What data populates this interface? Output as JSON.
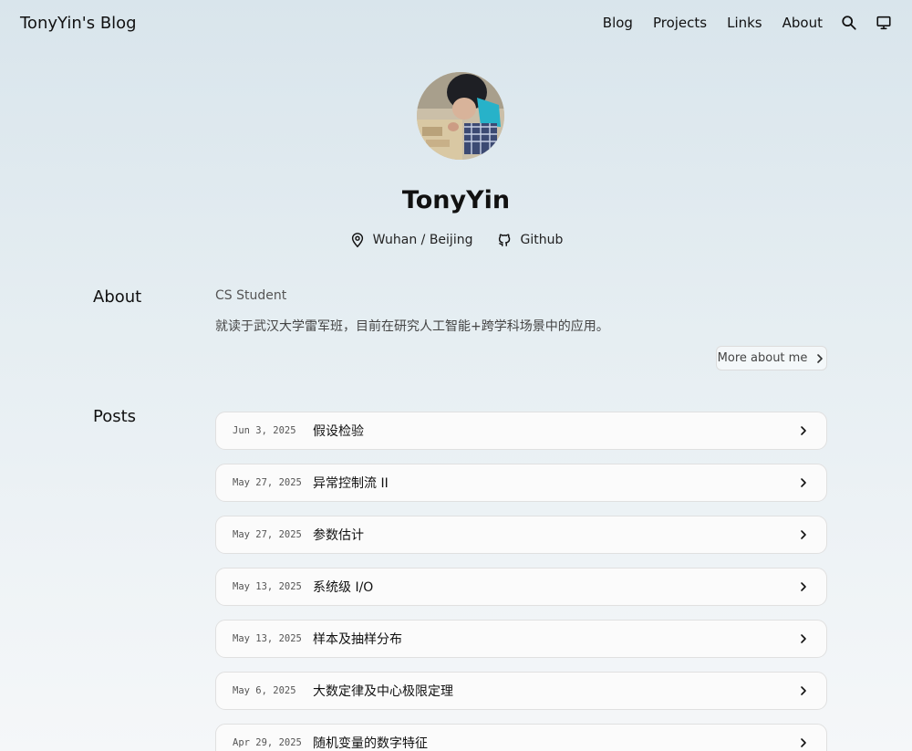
{
  "header": {
    "site_title": "TonyYin's Blog",
    "nav": [
      "Blog",
      "Projects",
      "Links",
      "About"
    ],
    "icons": [
      "search-icon",
      "monitor-icon"
    ]
  },
  "profile": {
    "name": "TonyYin",
    "location": "Wuhan / Beijing",
    "github_label": "Github"
  },
  "about": {
    "heading": "About",
    "subtitle": "CS Student",
    "description": "就读于武汉大学雷军班，目前在研究人工智能+跨学科场景中的应用。",
    "more_label": "More about me"
  },
  "posts": {
    "heading": "Posts",
    "items": [
      {
        "date": "Jun 3, 2025",
        "title": "假设检验"
      },
      {
        "date": "May 27, 2025",
        "title": "异常控制流 II"
      },
      {
        "date": "May 27, 2025",
        "title": "参数估计"
      },
      {
        "date": "May 13, 2025",
        "title": "系统级 I/O"
      },
      {
        "date": "May 13, 2025",
        "title": "样本及抽样分布"
      },
      {
        "date": "May 6, 2025",
        "title": "大数定律及中心极限定理"
      },
      {
        "date": "Apr 29, 2025",
        "title": "随机变量的数字特征"
      }
    ]
  },
  "colors": {
    "bg_top": "#d9e5ec",
    "bg_bottom": "#f5f7f9",
    "text": "#111111",
    "card_border": "#e0e0e0"
  }
}
